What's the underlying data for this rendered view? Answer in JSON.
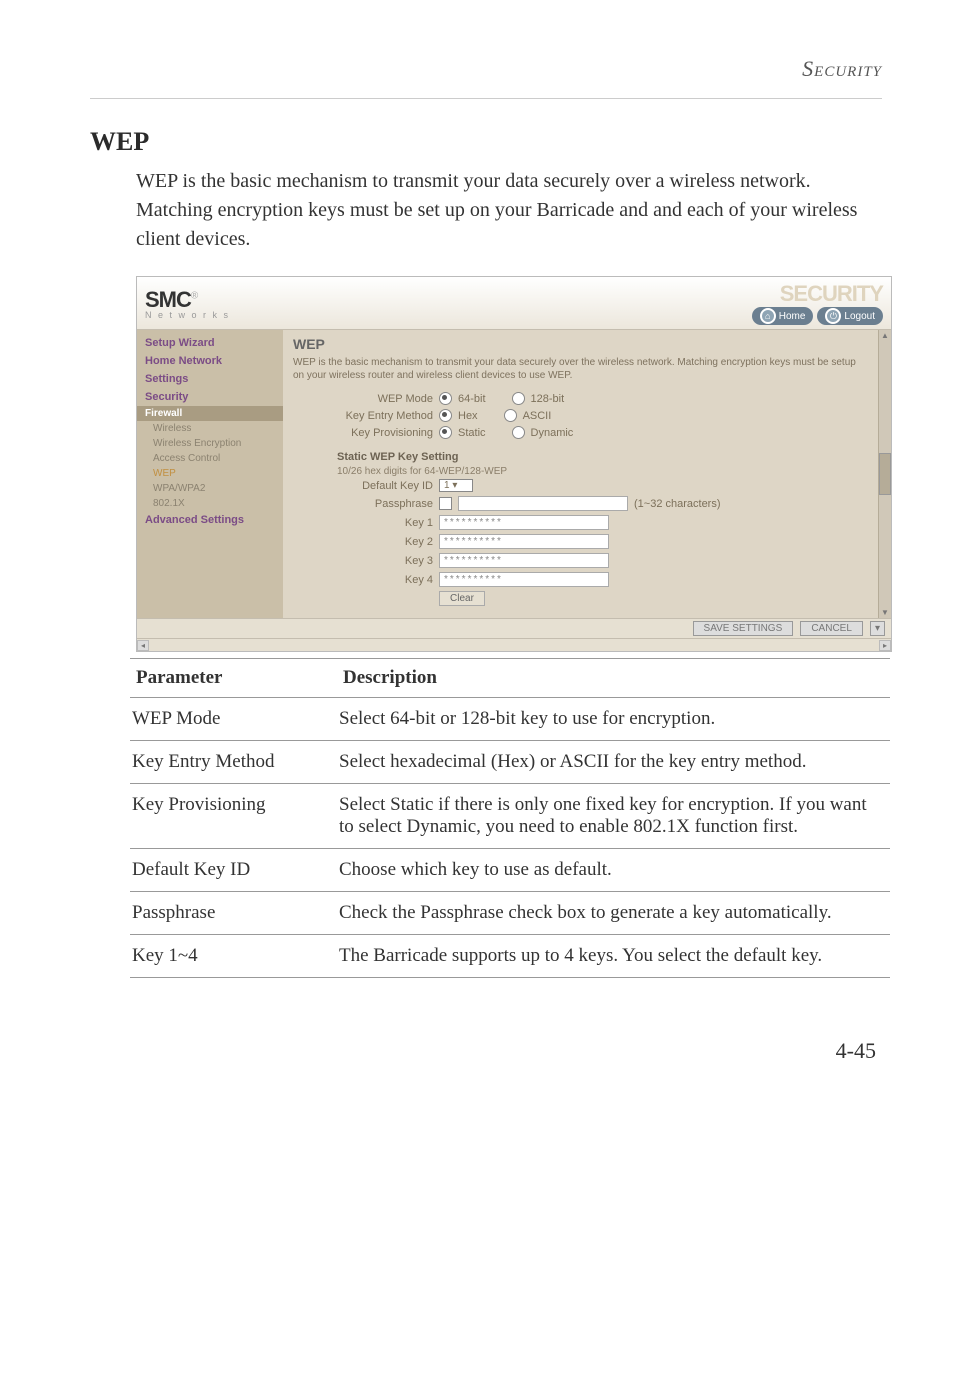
{
  "header": {
    "right_label": "Security"
  },
  "section": {
    "title": "WEP",
    "intro": "WEP is the basic mechanism to transmit your data securely over a wireless network. Matching encryption keys must be set up on your Barricade and and each of your wireless client devices."
  },
  "screenshot": {
    "logo": "SMC",
    "logo_sub": "N e t w o r k s",
    "right_logo": "SECURITY",
    "home_btn": "Home",
    "logout_btn": "Logout",
    "sidebar": {
      "items": [
        "Setup Wizard",
        "Home Network",
        "Settings",
        "Security"
      ],
      "sub_band": "Firewall",
      "subs": [
        "Wireless",
        "Wireless Encryption",
        "Access Control",
        "WEP",
        "WPA/WPA2",
        "802.1X"
      ],
      "adv": "Advanced Settings"
    },
    "panel": {
      "title": "WEP",
      "desc": "WEP is the basic mechanism to transmit your data securely over the wireless network. Matching encryption keys must be setup on your wireless router and wireless client devices to use WEP.",
      "rows": {
        "wep_mode_lbl": "WEP Mode",
        "wep_mode_a": "64-bit",
        "wep_mode_b": "128-bit",
        "key_entry_lbl": "Key Entry Method",
        "key_entry_a": "Hex",
        "key_entry_b": "ASCII",
        "key_prov_lbl": "Key Provisioning",
        "key_prov_a": "Static",
        "key_prov_b": "Dynamic"
      },
      "static_head": "Static WEP Key Setting",
      "static_note": "10/26 hex digits for 64-WEP/128-WEP",
      "default_key_lbl": "Default Key ID",
      "default_key_val": "1",
      "passphrase_lbl": "Passphrase",
      "passphrase_hint": "(1~32 characters)",
      "key1_lbl": "Key 1",
      "key2_lbl": "Key 2",
      "key3_lbl": "Key 3",
      "key4_lbl": "Key 4",
      "key_mask": "**********",
      "clear_btn": "Clear",
      "save_btn": "SAVE SETTINGS",
      "cancel_btn": "CANCEL"
    }
  },
  "table": {
    "head_param": "Parameter",
    "head_desc": "Description",
    "rows": [
      {
        "p": "WEP Mode",
        "d": "Select 64-bit or 128-bit key to use for encryption."
      },
      {
        "p": "Key Entry Method",
        "d": "Select hexadecimal (Hex) or ASCII for the key entry method."
      },
      {
        "p": "Key Provisioning",
        "d": "Select Static if there is only one fixed key for encryption. If you want to select Dynamic, you need to enable 802.1X function first."
      },
      {
        "p": "Default Key ID",
        "d": "Choose which key to use as default."
      },
      {
        "p": "Passphrase",
        "d": "Check the Passphrase check box to generate a key automatically."
      },
      {
        "p": "Key 1~4",
        "d": "The Barricade supports up to 4 keys. You select the default key."
      }
    ]
  },
  "page_number": "4-45"
}
